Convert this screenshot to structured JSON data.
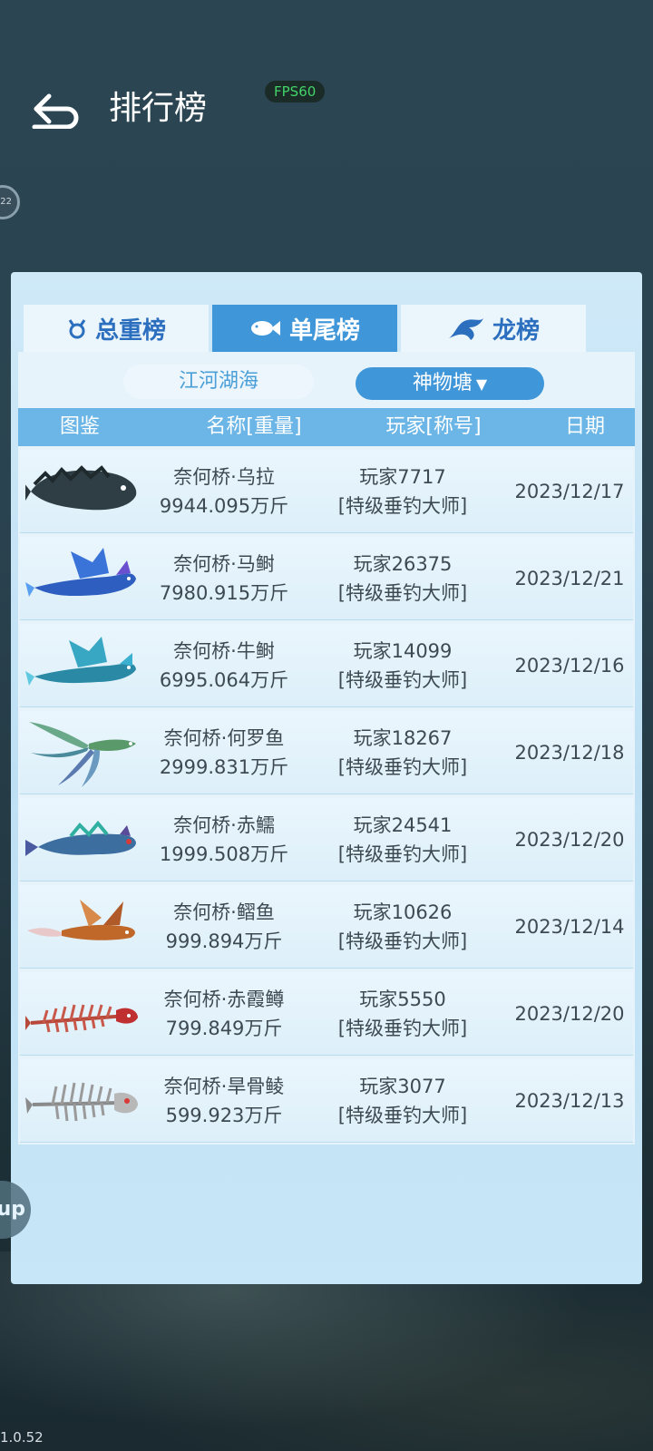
{
  "header": {
    "title": "排行榜",
    "fps": "FPS60",
    "side_badge": "22"
  },
  "tabs": [
    {
      "label": "总重榜",
      "icon": "trophy-icon",
      "active": false
    },
    {
      "label": "单尾榜",
      "icon": "fish-icon",
      "active": true
    },
    {
      "label": "龙榜",
      "icon": "dragon-icon",
      "active": false
    }
  ],
  "subtabs": {
    "static_label": "江河湖海",
    "selected_label": "神物塘",
    "selected_icon": "caret-down-icon"
  },
  "table": {
    "columns": [
      "图鉴",
      "名称[重量]",
      "玩家[称号]",
      "日期"
    ],
    "rows": [
      {
        "name": "奈何桥·乌拉",
        "weight": "9944.095万斤",
        "player": "玩家7717",
        "title": "[特级垂钓大师]",
        "date": "2023/12/17",
        "fish": "dark-scaled-fish"
      },
      {
        "name": "奈何桥·马鲥",
        "weight": "7980.915万斤",
        "player": "玩家26375",
        "title": "[特级垂钓大师]",
        "date": "2023/12/21",
        "fish": "blue-winged-horse-fish"
      },
      {
        "name": "奈何桥·牛鲥",
        "weight": "6995.064万斤",
        "player": "玩家14099",
        "title": "[特级垂钓大师]",
        "date": "2023/12/16",
        "fish": "cyan-winged-dragon-fish"
      },
      {
        "name": "奈何桥·何罗鱼",
        "weight": "2999.831万斤",
        "player": "玩家18267",
        "title": "[特级垂钓大师]",
        "date": "2023/12/18",
        "fish": "green-feather-tail-fish"
      },
      {
        "name": "奈何桥·赤鱬",
        "weight": "1999.508万斤",
        "player": "玩家24541",
        "title": "[特级垂钓大师]",
        "date": "2023/12/20",
        "fish": "blue-dragon-head-fish"
      },
      {
        "name": "奈何桥·鳛鱼",
        "weight": "999.894万斤",
        "player": "玩家10626",
        "title": "[特级垂钓大师]",
        "date": "2023/12/14",
        "fish": "orange-winged-fish"
      },
      {
        "name": "奈何桥·赤霞鳟",
        "weight": "799.849万斤",
        "player": "玩家5550",
        "title": "[特级垂钓大师]",
        "date": "2023/12/20",
        "fish": "red-bone-fish"
      },
      {
        "name": "奈何桥·旱骨鲮",
        "weight": "599.923万斤",
        "player": "玩家3077",
        "title": "[特级垂钓大师]",
        "date": "2023/12/13",
        "fish": "white-bone-fish"
      }
    ]
  },
  "side_float_label": "up",
  "version": "1.0.52",
  "colors": {
    "accent": "#3f96d8",
    "header_row": "#6bb6e6",
    "tab_text": "#2c6fbf",
    "fps_green": "#43d46a"
  }
}
